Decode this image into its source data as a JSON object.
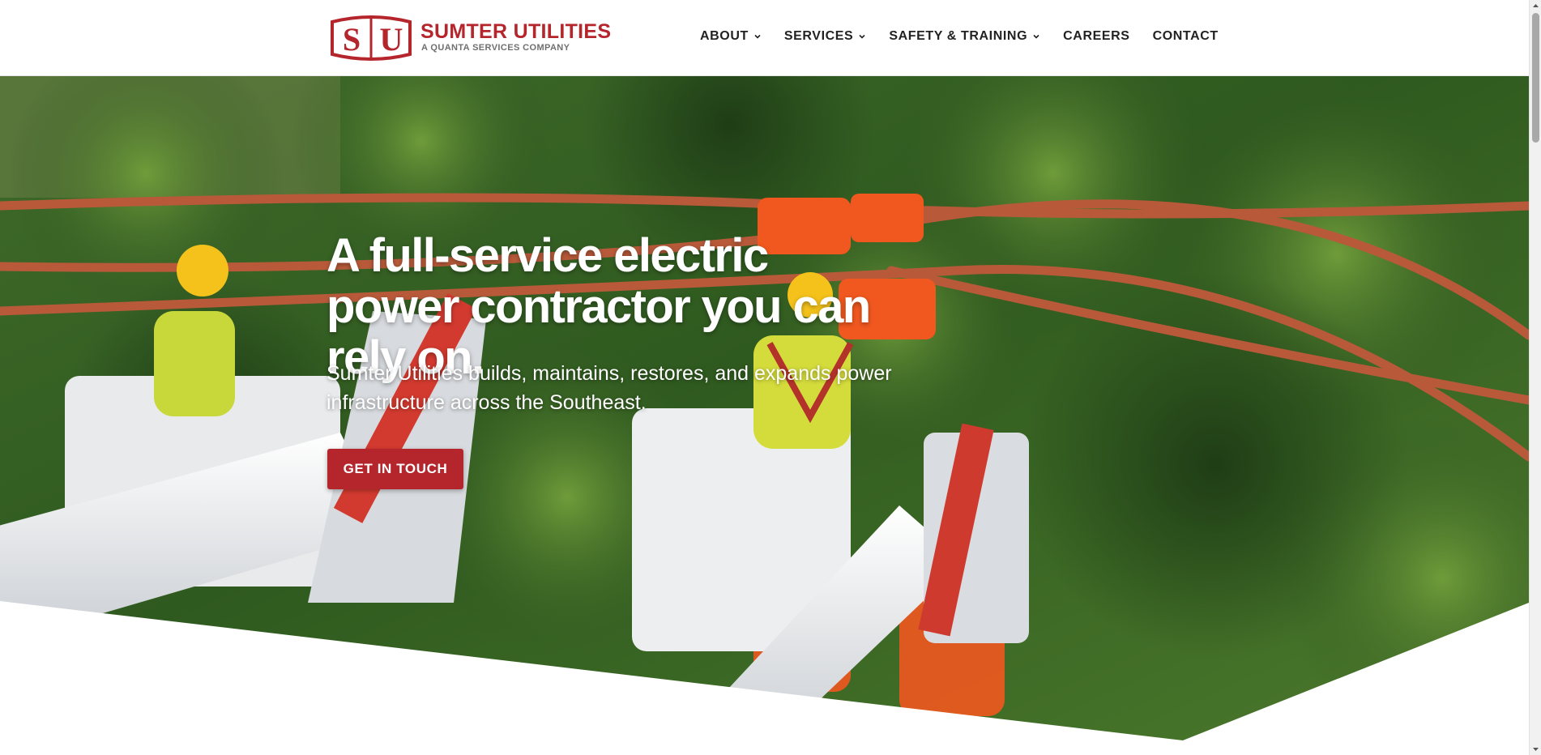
{
  "brand": {
    "mark_letters": "SU",
    "name": "SUMTER UTILITIES",
    "tagline": "A QUANTA SERVICES COMPANY",
    "brand_color": "#b5262c",
    "logo_icon": "su-logo-icon"
  },
  "nav": {
    "about": "ABOUT",
    "services": "SERVICES",
    "safety": "SAFETY & TRAINING",
    "careers": "CAREERS",
    "contact": "CONTACT",
    "dropdown_icon": "chevron-down-icon"
  },
  "hero": {
    "headline": "A full-service electric power contractor you can rely on.",
    "subline": "Sumter Utilities builds, maintains, restores, and expands power infrastructure across the Southeast.",
    "cta_label": "GET IN TOUCH",
    "cta_color": "#b5262c",
    "background_image": "line-workers-in-bucket-trucks-photo"
  }
}
